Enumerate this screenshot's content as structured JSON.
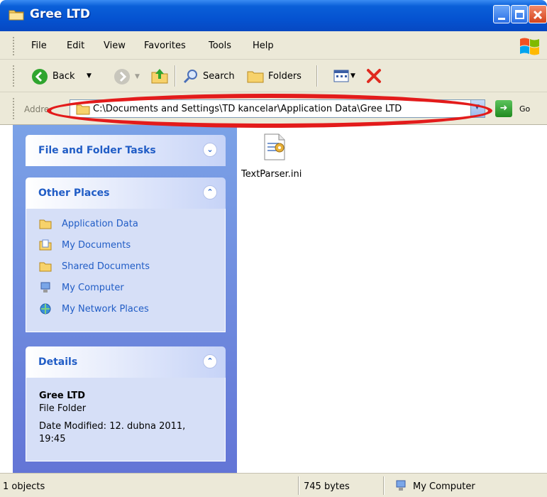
{
  "window": {
    "title": "Gree LTD",
    "controls": [
      "minimize-icon",
      "maximize-icon",
      "close-icon"
    ]
  },
  "menu": {
    "items": [
      "File",
      "Edit",
      "View",
      "Favorites",
      "Tools",
      "Help"
    ]
  },
  "toolbar": {
    "back_label": "Back",
    "search_label": "Search",
    "folders_label": "Folders"
  },
  "address": {
    "label": "Addre",
    "path": "C:\\Documents and Settings\\TD kancelar\\Application Data\\Gree LTD",
    "go_label": "Go"
  },
  "taskpane": {
    "file_folder_tasks": "File and Folder Tasks",
    "other_places": {
      "title": "Other Places",
      "items": [
        "Application Data",
        "My Documents",
        "Shared Documents",
        "My Computer",
        "My Network Places"
      ]
    },
    "details": {
      "title": "Details",
      "name": "Gree LTD",
      "type": "File Folder",
      "date_modified": "Date Modified: 12. dubna 2011, 19:45"
    }
  },
  "content": {
    "files": [
      {
        "name": "TextParser.ini",
        "icon": "ini-file-icon"
      }
    ]
  },
  "status": {
    "objects": "1 objects",
    "size": "745 bytes",
    "location": "My Computer"
  },
  "colors": {
    "titlebar": "#0553d1",
    "taskpane_link": "#215dc6",
    "highlight": "#e31b1b"
  }
}
